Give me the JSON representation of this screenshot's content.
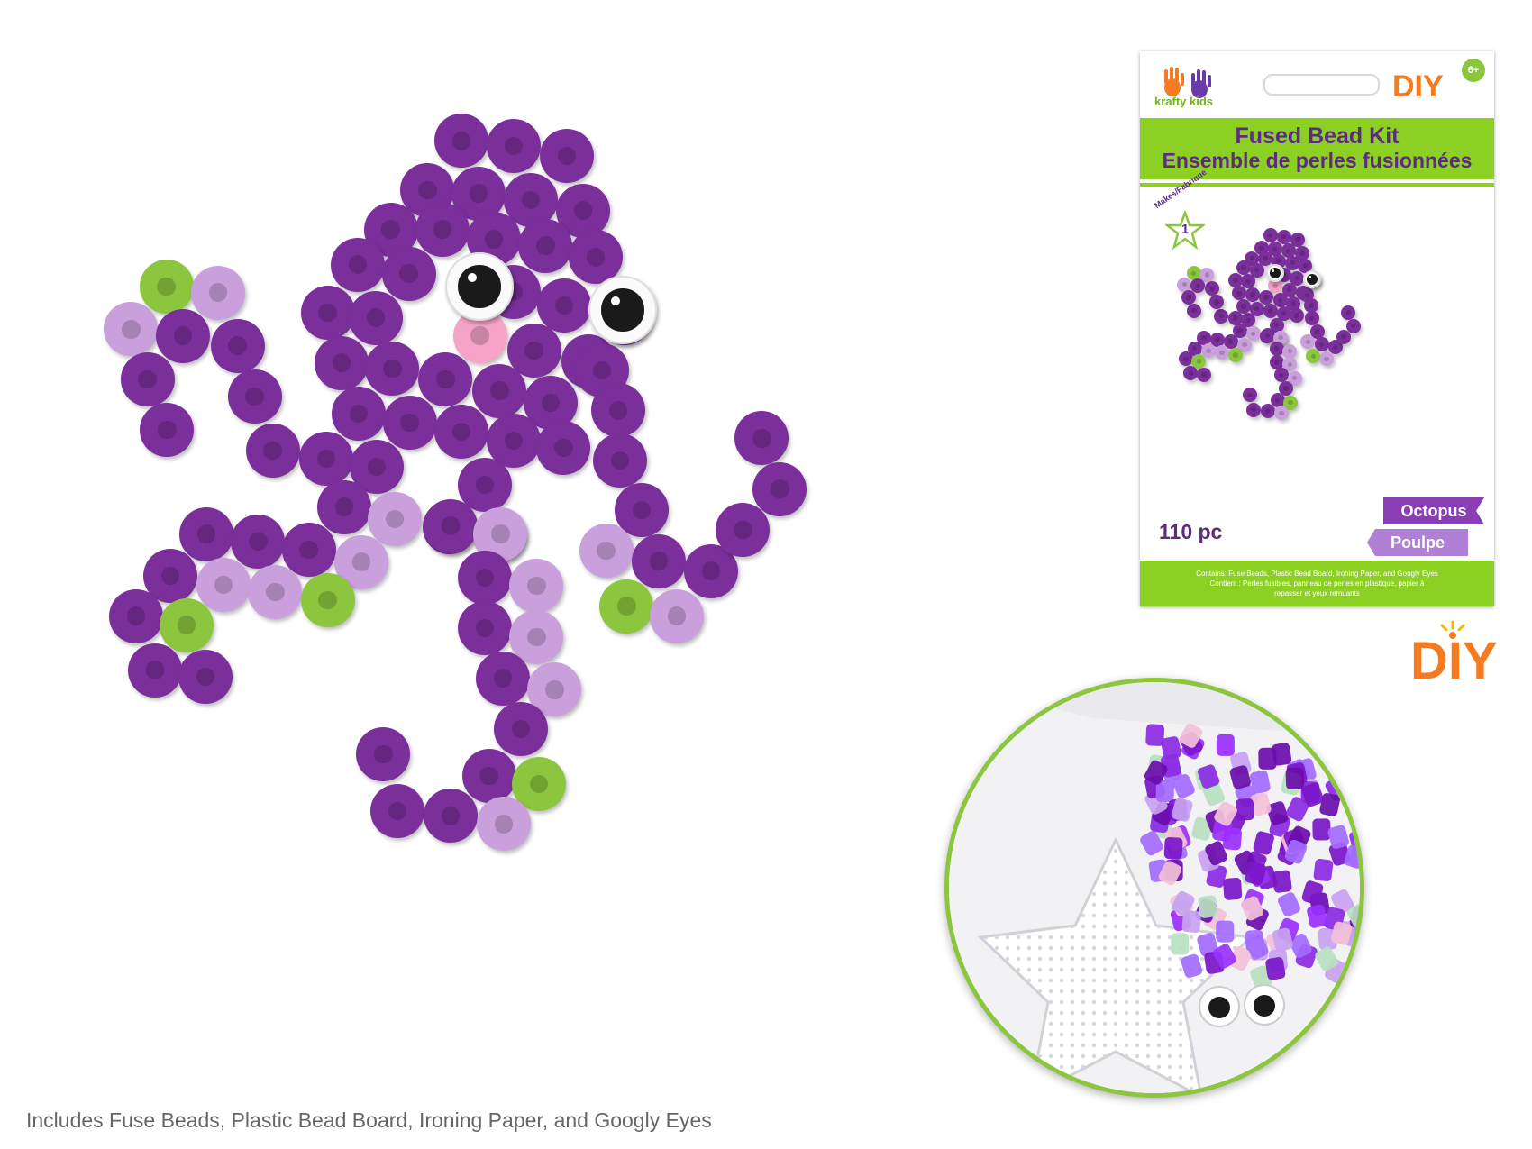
{
  "colors": {
    "dark_purple": "#7b2f9b",
    "light_purple": "#c9a0dc",
    "lime_green": "#8cc63f",
    "pink": "#f5a3c7",
    "orange": "#f47b20",
    "package_green": "#8cd024",
    "package_text_purple": "#5e2a84"
  },
  "package": {
    "brand": "krafty kids",
    "logo_icon": "handprints-icon",
    "diy": "DIY",
    "age": "6+",
    "title_en": "Fused Bead Kit",
    "title_fr": "Ensemble de perles fusionnées",
    "makes_label": "Makes/Fabrique",
    "makes_count": "1",
    "count": "110 pc",
    "name_en": "Octopus",
    "name_fr": "Poulpe",
    "contents_en": "Contains: Fuse Beads, Plastic Bead Board, Ironing Paper, and Googly Eyes",
    "contents_fr_1": "Contient : Perles fusibles, panneau de perles en plastique, papier à",
    "contents_fr_2": "repasser et yeux remuants"
  },
  "diy_label": "DIY",
  "caption": "Includes Fuse Beads, Plastic Bead Board, Ironing Paper, and Googly Eyes"
}
